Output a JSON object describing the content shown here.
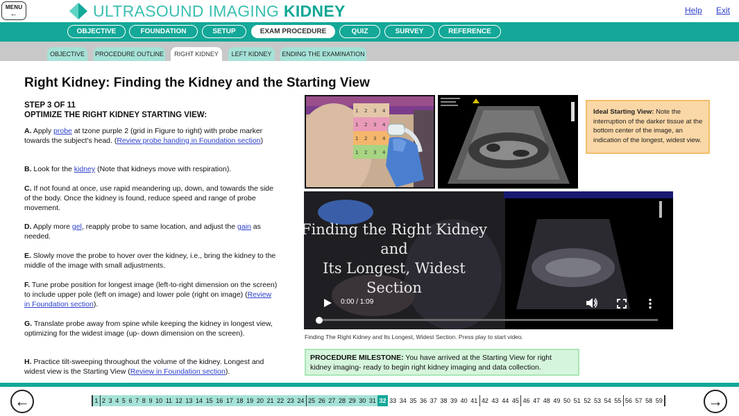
{
  "header": {
    "menu_label": "MENU",
    "title_light": "ULTRASOUND IMAGING ",
    "title_bold": "KIDNEY",
    "help": "Help",
    "exit": "Exit"
  },
  "nav_primary": {
    "tabs": [
      "OBJECTIVE",
      "FOUNDATION",
      "SETUP",
      "EXAM PROCEDURE",
      "QUIZ",
      "SURVEY",
      "REFERENCE"
    ],
    "active": "EXAM PROCEDURE"
  },
  "nav_secondary": {
    "tabs": [
      "OBJECTIVE",
      "PROCEDURE OUTLINE",
      "RIGHT KIDNEY",
      "LEFT KIDNEY",
      "ENDING THE EXAMINATION"
    ],
    "active": "RIGHT KIDNEY"
  },
  "content": {
    "title": "Right Kidney:  Finding the Kidney and the Starting View",
    "step": "STEP 3 OF 11",
    "subheading": "OPTIMIZE THE RIGHT KIDNEY STARTING VIEW:",
    "instructions": {
      "a": {
        "letter": "A.",
        "pre": "Apply ",
        "link1": "probe",
        "mid": " at tzone purple 2 (grid in Figure to right) with probe marker towards the subject's head. (",
        "link2": "Review probe handing in Foundation section",
        "post": ")"
      },
      "b": {
        "letter": "B.",
        "pre": "Look for the ",
        "link1": "kidney",
        "post": " (Note that kidneys move with respiration)."
      },
      "c": {
        "letter": "C.",
        "text": "If not found at once, use rapid meandering up, down, and towards the side of the body. Once the kidney is found, reduce speed and range of probe movement."
      },
      "d": {
        "letter": "D.",
        "pre": "Apply more ",
        "link1": "gel",
        "mid": ", reapply probe to same location, and adjust the ",
        "link2": "gain",
        "post": " as needed."
      },
      "e": {
        "letter": "E.",
        "text": "Slowly move the probe to hover over the kidney, i.e., bring the kidney to the middle of the image with small adjustments."
      },
      "f": {
        "letter": "F.",
        "pre": "Tune probe position for longest image (left-to-right dimension on the screen) to include upper pole (left on image) and lower pole (right on image) (",
        "link1": "Review in Foundation section",
        "post": ")."
      },
      "g": {
        "letter": "G.",
        "text": "Translate probe away from spine while keeping the kidney in longest view, optimizing for the widest image (up- down dimension on the screen)."
      },
      "h": {
        "letter": "H.",
        "pre": "Practice tilt-sweeping throughout the volume of the kidney. Longest and widest view is the Starting View (",
        "link1": "Review in Foundation section",
        "post": ")."
      }
    },
    "grid_numbers": [
      "1",
      "2",
      "3",
      "4",
      "1",
      "2",
      "3",
      "4",
      "1",
      "2",
      "3",
      "4",
      "1",
      "2",
      "3",
      "4"
    ],
    "ideal_box": {
      "bold": "Ideal Starting View:",
      "text": " Note the interruption of the darker tissue at the bottom center of the image, an indication of the longest, widest view."
    },
    "video": {
      "title_line1": "Finding the Right Kidney",
      "title_line2": "and",
      "title_line3": "Its Longest, Widest",
      "title_line4": "Section",
      "time": "0:00 / 1:09",
      "progress": 0.0
    },
    "video_caption": "Finding The Right Kidney and Its Longest, Widest Section. Press play to start video.",
    "milestone": {
      "bold": "PROCEDURE MILESTONE:",
      "text": " You have arrived at the Starting View for right kidney imaging- ready to begin right kidney imaging and data collection."
    }
  },
  "pagination": {
    "pages": [
      "1",
      "2",
      "3",
      "4",
      "5",
      "6",
      "7",
      "8",
      "9",
      "10",
      "11",
      "12",
      "13",
      "14",
      "15",
      "16",
      "17",
      "18",
      "19",
      "20",
      "21",
      "22",
      "23",
      "24",
      "25",
      "26",
      "27",
      "28",
      "29",
      "30",
      "31",
      "32",
      "33",
      "34",
      "35",
      "36",
      "37",
      "38",
      "39",
      "40",
      "41",
      "42",
      "43",
      "44",
      "45",
      "46",
      "47",
      "48",
      "49",
      "50",
      "51",
      "52",
      "53",
      "54",
      "55",
      "56",
      "57",
      "58",
      "59"
    ],
    "current": "32",
    "completed_through": 31,
    "section_starts": [
      "2",
      "25",
      "42",
      "46",
      "56"
    ]
  },
  "colors": {
    "teal": "#14a898",
    "title_teal": "#11a796",
    "nav2_tab": "#a6e2d8",
    "ideal_bg": "#fad7a6",
    "milestone_bg": "#d6f5dd",
    "link": "#2b3fcc"
  }
}
